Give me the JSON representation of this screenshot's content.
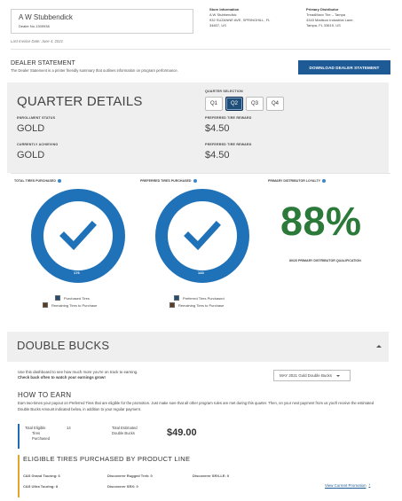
{
  "dealer": {
    "name": "A W Stubbendick",
    "dealer_no": "Dealer No.1309938",
    "last_invoice": "Last Invoice Date: June 4, 2021"
  },
  "store_info": {
    "heading": "Store Information",
    "lines": [
      "A W Stubbendick",
      "932 SUZANNE AVE, SPRINGHILL, FL",
      "34607, US"
    ]
  },
  "primary_distributor": {
    "heading": "Primary Distributor",
    "lines": [
      "TreadMaxx Tire – Tampa",
      "4343 Madison Industrial Lane,",
      "Tampa, FL 33619, US"
    ]
  },
  "dealer_statement": {
    "title": "DEALER STATEMENT",
    "description": "The Dealer Statement is a printer friendly summary that outlines information on program performance.",
    "download_label": "DOWNLOAD DEALER STATEMENT"
  },
  "quarter": {
    "title": "QUARTER DETAILS",
    "selection_label": "QUARTER SELECTION",
    "options": [
      "Q1",
      "Q2",
      "Q3",
      "Q4"
    ],
    "selected": "Q2",
    "enrollment_status_label": "ENROLLMENT STATUS",
    "enrollment_status": "GOLD",
    "currently_achieving_label": "CURRENTLY ACHIEVING",
    "currently_achieving": "GOLD",
    "reward_label_1": "PREFERRED TIRE REWARD",
    "reward_1": "$4.50",
    "reward_label_2": "PREFERRED TIRE REWARD",
    "reward_2": "$4.50"
  },
  "charts": {
    "total": {
      "label": "TOTAL TIRES PURCHASED",
      "value_label": "176",
      "legend": [
        "Purchased Tires",
        "Remaining Tires to Purchase"
      ]
    },
    "preferred": {
      "label": "PREFERRED TIRES PURCHASED",
      "value_label": "143",
      "legend": [
        "Preferred Tires Purchased",
        "Remaining Tires to Purchase"
      ]
    },
    "loyalty": {
      "label": "PRIMARY DISTRIBUTOR LOYALTY",
      "percent": "88%",
      "sub": "80/20 PRIMARY DISTRIBUTOR QUALIFICATION"
    },
    "colors": {
      "donut": "#1f72b8",
      "check": "#1f72b8",
      "purchased_swatch": "#1f4e79",
      "remaining_swatch": "#5a3d24",
      "loyalty_text": "#2c7a3a"
    }
  },
  "double_bucks": {
    "title": "DOUBLE BUCKS",
    "intro_1": "Use this dashboard to see how much more you're on track to earning.",
    "intro_2": "Check back often to watch your earnings grow!",
    "dropdown_value": "MAY 2021 Gold Double Bucks",
    "how_title": "HOW TO EARN",
    "how_desc": "Earn two-times your payout on Preferred Tires that are eligible for the promotion. Just make sure that all other program rules are met during this quarter. Then, on your next payment from us you'll receive the estimated Double Bucks Amount indicated below, in addition to your regular payment.",
    "total_eligible_label": [
      "Total Eligible",
      "Tires",
      "Purchased"
    ],
    "total_eligible_value": "14",
    "total_estimated_label": [
      "Total Estimated",
      "Double Bucks"
    ],
    "total_estimated_value": "$49.00",
    "eligible_title": "ELIGIBLE TIRES PURCHASED BY PRODUCT LINE",
    "product_lines": [
      "C&S Grand Touring: 6",
      "Discoverer Rugged Trek: 0",
      "Discoverer SRX-LE: 0",
      "C&S Ultra Touring: 8",
      "Discoverer SRX: 0"
    ],
    "view_promo_label": "View Current Promotion"
  },
  "colors": {
    "accent_blue": "#1d5a96",
    "how_border": "#1f6db5",
    "eligible_border": "#e3a52a"
  }
}
